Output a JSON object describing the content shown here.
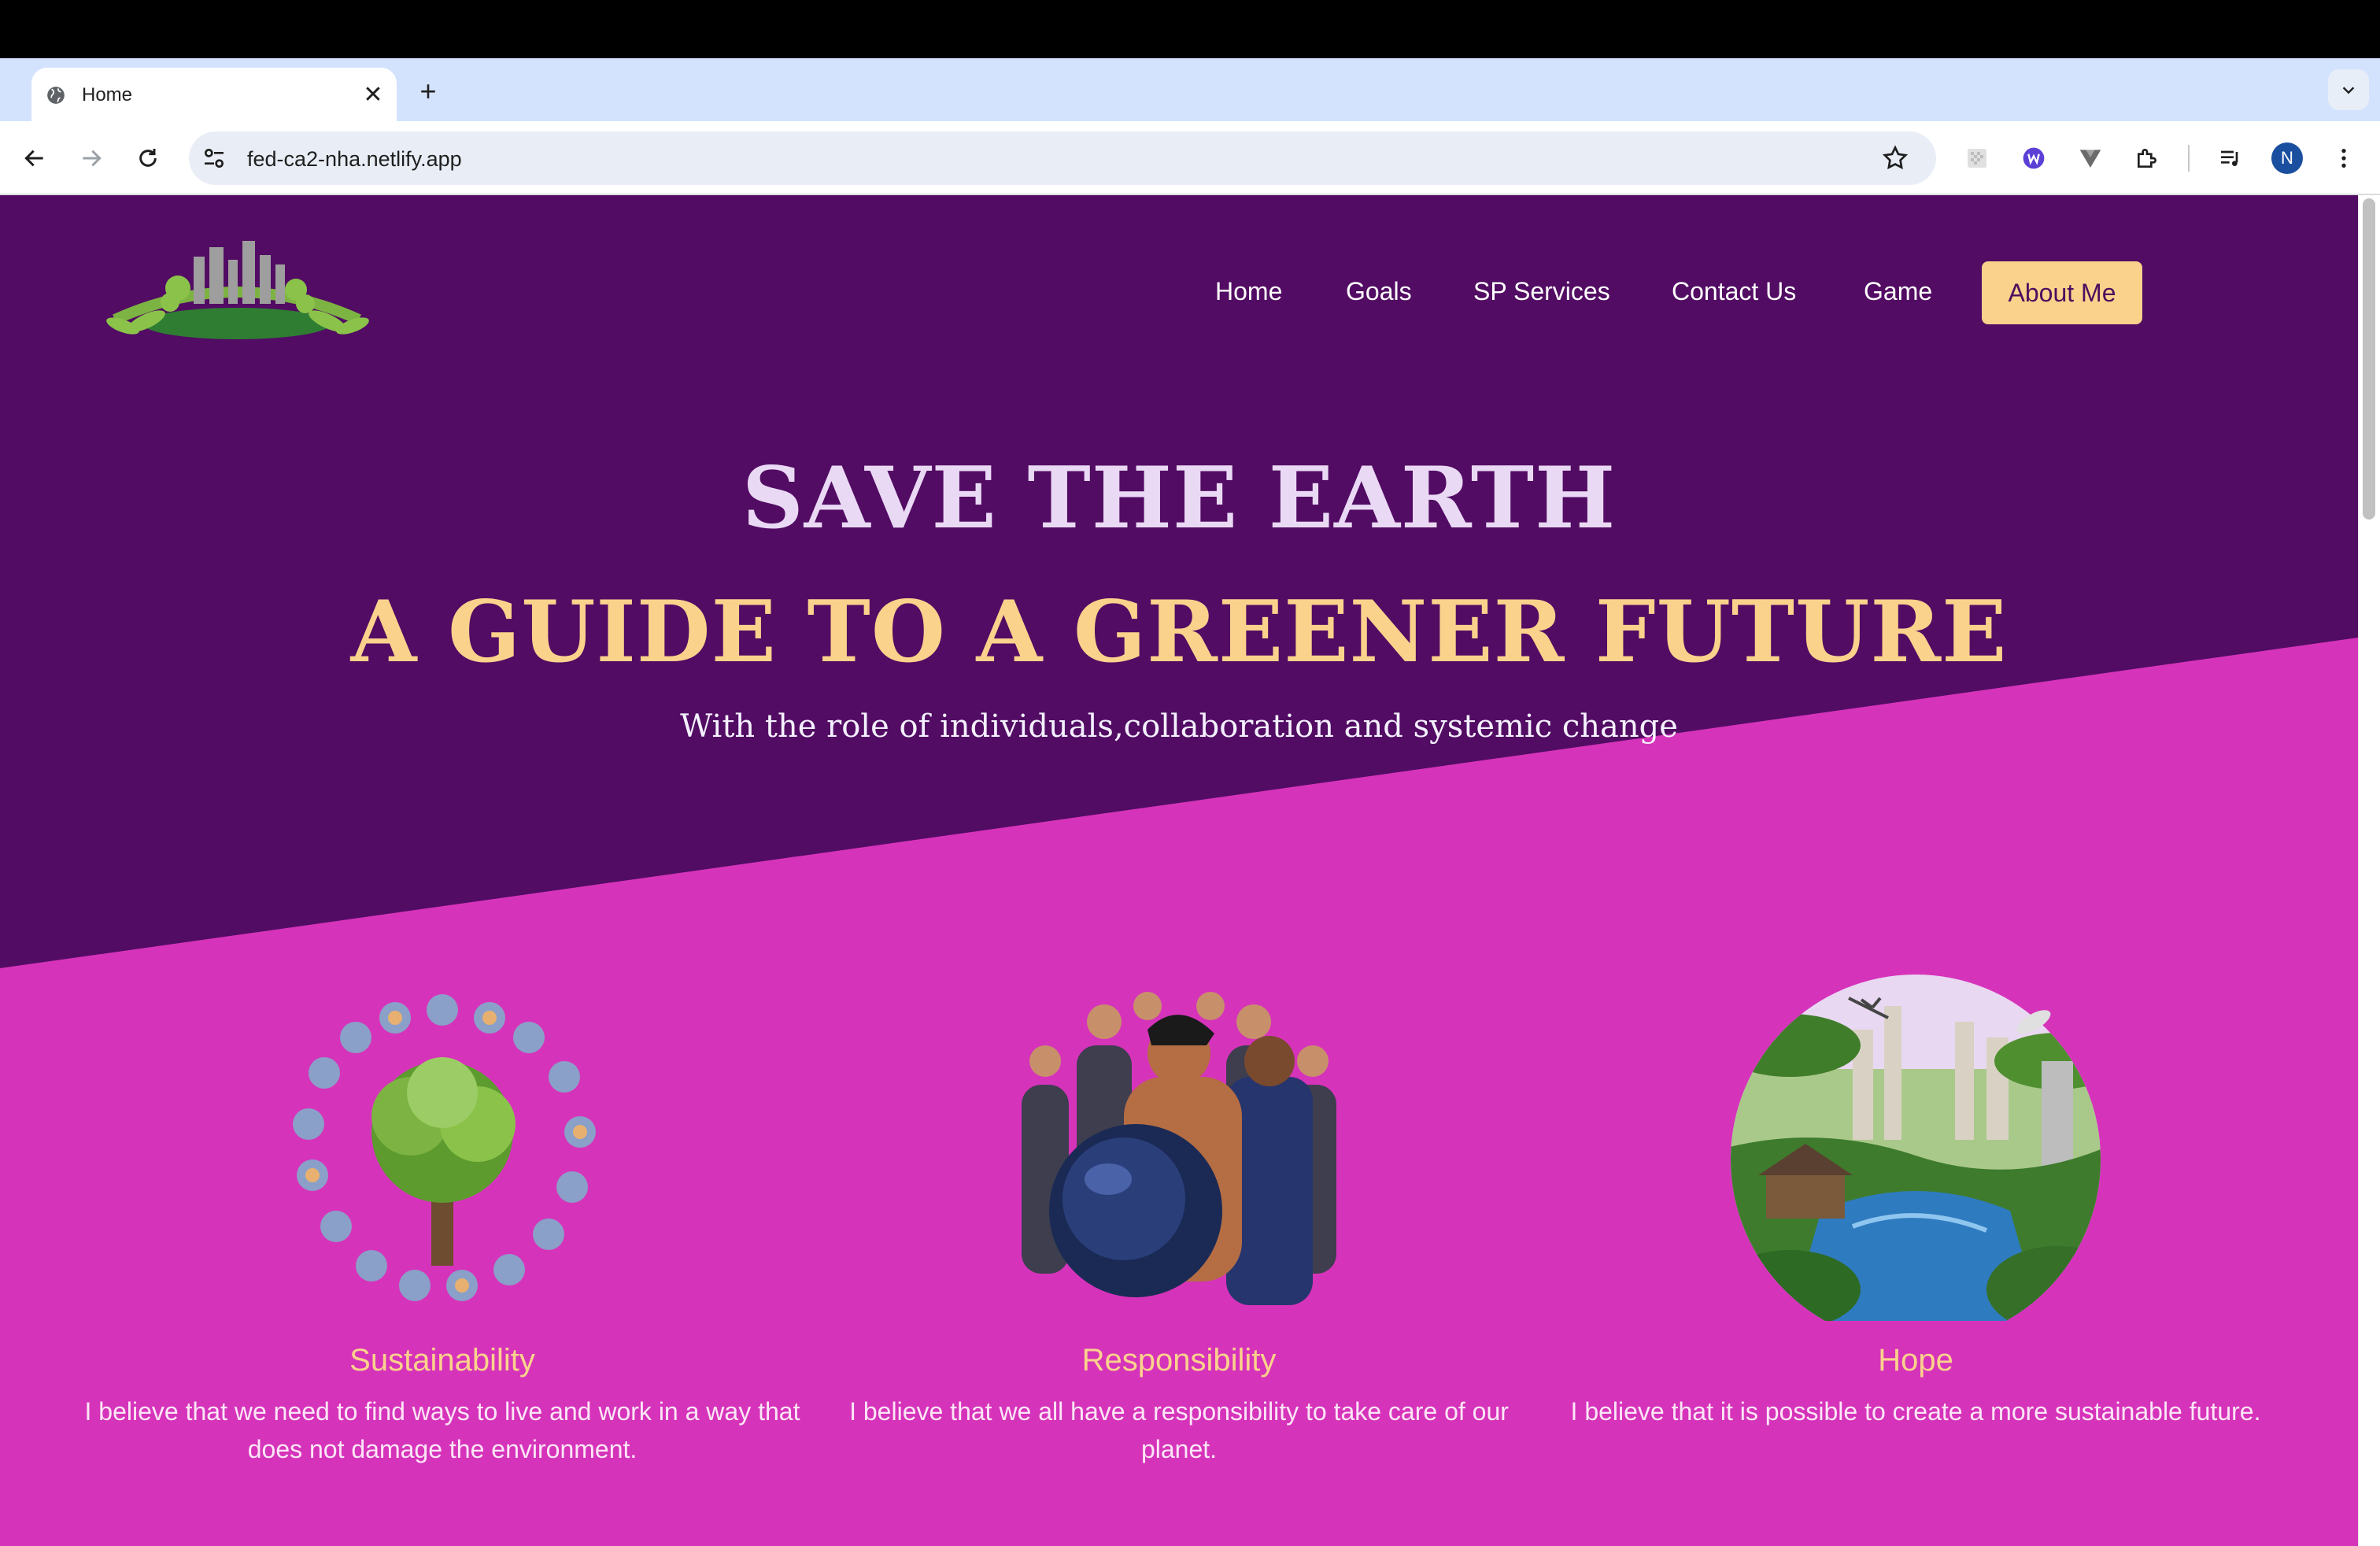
{
  "browser": {
    "tab_title": "Home",
    "close_glyph": "✕",
    "new_tab_glyph": "+",
    "url": "fed-ca2-nha.netlify.app",
    "profile_initial": "N"
  },
  "nav": {
    "links": [
      "Home",
      "Goals",
      "SP Services",
      "Contact Us",
      "Game"
    ],
    "cta": "About Me"
  },
  "hero": {
    "title": "SAVE THE EARTH",
    "subtitle": "A GUIDE TO A GREENER FUTURE",
    "tagline": "With the role of individuals,collaboration and systemic change"
  },
  "values": [
    {
      "title": "Sustainability",
      "text": "I believe that we need to find ways to live and work in a way that does not damage the environment.",
      "image": "people-circle-tree"
    },
    {
      "title": "Responsibility",
      "text": "I believe that we all have a responsibility to take care of our planet.",
      "image": "crowd-holding-earth"
    },
    {
      "title": "Hope",
      "text": "I believe that it is possible to create a more sustainable future.",
      "image": "green-future-city"
    }
  ],
  "colors": {
    "page_purple": "#520c63",
    "page_magenta": "#d633bb",
    "accent_gold": "#fbd28c"
  }
}
